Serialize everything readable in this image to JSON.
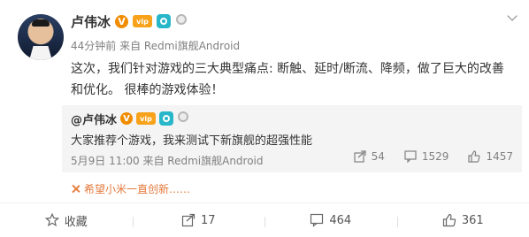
{
  "post": {
    "author": "卢伟冰",
    "verified_badge": "V",
    "vip_badge": "vip",
    "meta": "44分钟前 来自 Redmi旗舰Android",
    "content": "这次，我们针对游戏的三大典型痛点: 断触、延时/断流、降频，做了巨大的改善和优化。 很棒的游戏体验！"
  },
  "repost": {
    "author": "@卢伟冰",
    "text": "大家推荐个游戏，我来测试下新旗舰的超强性能",
    "meta": "5月9日 11:00 来自 Redmi旗舰Android",
    "share_count": "54",
    "comment_count": "1529",
    "like_count": "1457"
  },
  "comment_preview": {
    "text": "希望小米一直创新……"
  },
  "footer": {
    "favorite_label": "收藏",
    "repost_count": "17",
    "comment_count": "464",
    "like_count": "361"
  },
  "colors": {
    "accent_orange": "#f08c00",
    "text_gray": "#808080",
    "repost_bg": "#f4f4f4",
    "comment_orange": "#e3793b"
  },
  "icons": [
    "chevron-down-icon",
    "verified-icon",
    "vip-icon",
    "camera-icon",
    "medal-icon",
    "share-icon",
    "comment-icon",
    "like-icon",
    "star-icon"
  ]
}
